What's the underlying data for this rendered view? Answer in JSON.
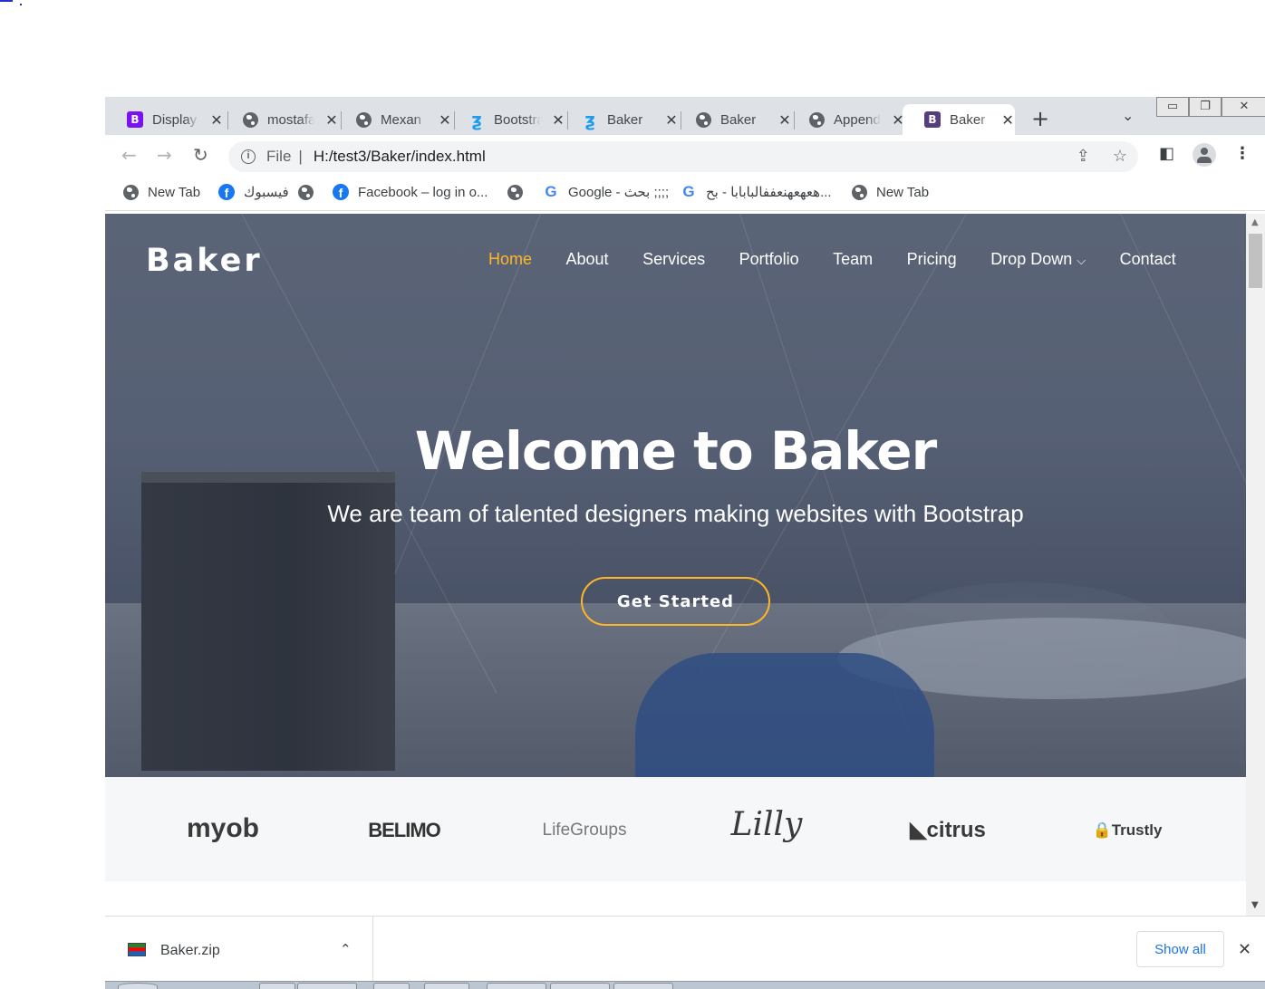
{
  "browser": {
    "tabs": [
      {
        "title": "Display",
        "favicon": "bootstrap-icon"
      },
      {
        "title": "mostafa",
        "favicon": "globe-icon"
      },
      {
        "title": "Mexan",
        "favicon": "globe-icon"
      },
      {
        "title": "Bootstrap",
        "favicon": "tailwind-icon"
      },
      {
        "title": "Baker",
        "favicon": "tailwind-icon"
      },
      {
        "title": "Baker",
        "favicon": "globe-icon"
      },
      {
        "title": "Append",
        "favicon": "globe-icon"
      },
      {
        "title": "Baker",
        "favicon": "bootstrap-icon",
        "active": true
      }
    ],
    "new_tab_symbol": "+",
    "address": {
      "scheme": "File",
      "path": "H:/test3/Baker/index.html"
    },
    "bookmarks": [
      {
        "label": "New Tab",
        "icon": "globe-icon"
      },
      {
        "label": "فيسبوك",
        "icon": "facebook-icon"
      },
      {
        "label": "",
        "icon": "globe-icon"
      },
      {
        "label": "Facebook – log in o...",
        "icon": "facebook-icon"
      },
      {
        "label": "",
        "icon": "globe-icon"
      },
      {
        "label": "Google - بحث ;;;;",
        "icon": "google-icon"
      },
      {
        "label": "هعهعهنعففالبابابا - بح...",
        "icon": "google-icon"
      },
      {
        "label": "New Tab",
        "icon": "globe-icon"
      }
    ]
  },
  "site": {
    "logo": "Baker",
    "nav": [
      {
        "label": "Home",
        "active": true
      },
      {
        "label": "About"
      },
      {
        "label": "Services"
      },
      {
        "label": "Portfolio"
      },
      {
        "label": "Team"
      },
      {
        "label": "Pricing"
      },
      {
        "label": "Drop Down"
      },
      {
        "label": "Contact"
      }
    ],
    "hero": {
      "title": "Welcome to Baker",
      "subtitle": "We are team of talented designers making websites with Bootstrap",
      "cta": "Get Started"
    },
    "clients": [
      "myob",
      "BELIMO",
      "LifeGroups",
      "Lilly",
      "citrus",
      "Trustly"
    ],
    "accent_color": "#fcb628"
  },
  "downloads": {
    "file": "Baker.zip",
    "show_all": "Show all"
  }
}
